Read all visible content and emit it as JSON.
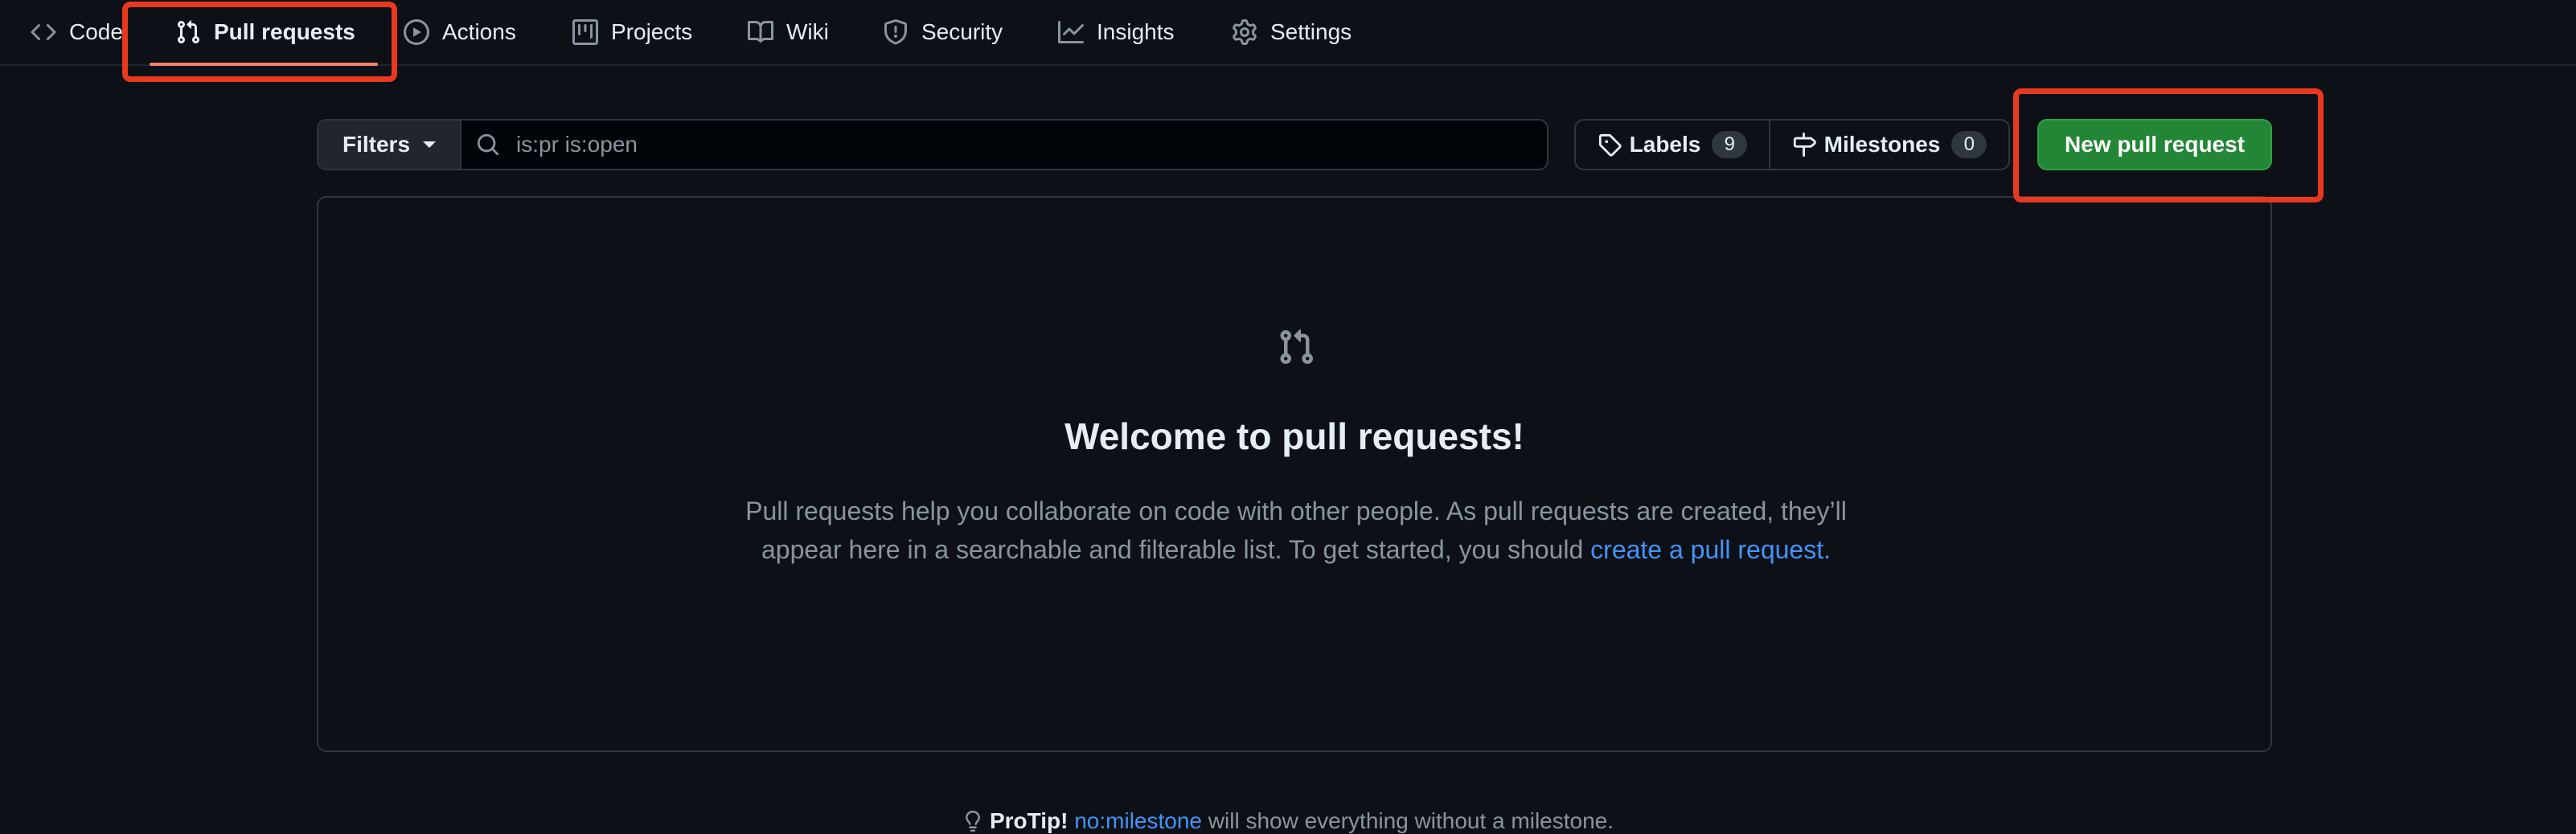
{
  "nav": {
    "items": [
      {
        "label": "Code",
        "icon": "code-icon"
      },
      {
        "label": "Pull requests",
        "icon": "git-pull-request-icon",
        "selected": true
      },
      {
        "label": "Actions",
        "icon": "play-icon"
      },
      {
        "label": "Projects",
        "icon": "table-icon"
      },
      {
        "label": "Wiki",
        "icon": "book-icon"
      },
      {
        "label": "Security",
        "icon": "shield-icon"
      },
      {
        "label": "Insights",
        "icon": "graph-icon"
      },
      {
        "label": "Settings",
        "icon": "gear-icon"
      }
    ]
  },
  "toolbar": {
    "filters_label": "Filters",
    "search_value": "is:pr is:open",
    "labels_label": "Labels",
    "labels_count": "9",
    "milestones_label": "Milestones",
    "milestones_count": "0",
    "new_pr_label": "New pull request"
  },
  "blankslate": {
    "title": "Welcome to pull requests!",
    "description": "Pull requests help you collaborate on code with other people. As pull requests are created, they’ll appear here in a searchable and filterable list. To get started, you should",
    "link_text": "create a pull request."
  },
  "protip": {
    "lead": "ProTip!",
    "link_text": "no:milestone",
    "rest": "will show everything without a milestone."
  },
  "colors": {
    "background": "#0d1117",
    "border": "#30363d",
    "accent_underline": "#f78166",
    "primary_button": "#238636",
    "link": "#4493f8",
    "annotation": "#e8381f"
  }
}
